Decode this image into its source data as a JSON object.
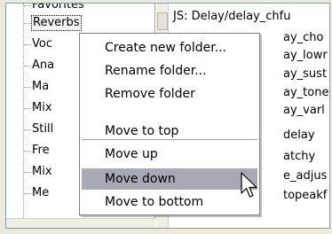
{
  "tree": {
    "items": [
      {
        "label": "Favorites"
      },
      {
        "label": "Reverbs",
        "selected": true
      },
      {
        "label": "Voc"
      },
      {
        "label": "Ana"
      },
      {
        "label": "Ma"
      },
      {
        "label": "Mix"
      },
      {
        "label": "Still"
      },
      {
        "label": "Fre"
      },
      {
        "label": "Mix"
      },
      {
        "label": "Me"
      }
    ]
  },
  "list": {
    "items": [
      "JS: Delay/delay_chfu",
      "ay_cho",
      "ay_lowr",
      "ay_sust",
      "ay_tone",
      "ay_varl",
      "delay",
      "atchy",
      "e_adjus",
      "topeakf"
    ]
  },
  "context_menu": {
    "items": [
      {
        "label": "Create new folder..."
      },
      {
        "label": "Rename folder..."
      },
      {
        "label": "Remove folder"
      },
      {
        "label": "Move to top"
      },
      {
        "label": "Move up"
      },
      {
        "label": "Move down",
        "highlighted": true
      },
      {
        "label": "Move to bottom"
      }
    ],
    "highlight_color": "#a9a9b5"
  },
  "icons": {
    "cursor": "arrow-cursor-icon"
  }
}
